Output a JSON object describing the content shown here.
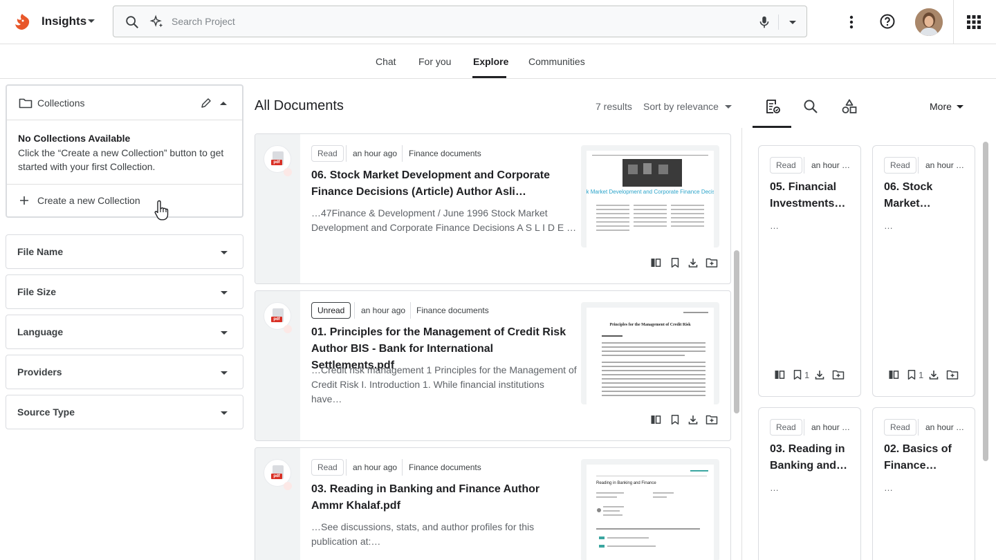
{
  "header": {
    "app_name": "Insights",
    "search_placeholder": "Search Project"
  },
  "tabs": [
    "Chat",
    "For you",
    "Explore",
    "Communities"
  ],
  "active_tab": "Explore",
  "collections": {
    "title": "Collections",
    "empty_title": "No Collections Available",
    "empty_desc": "Click the “Create a new Collection” button to get started with your first Collection.",
    "create_label": "Create a new Collection"
  },
  "filters": [
    "File Name",
    "File Size",
    "Language",
    "Providers",
    "Source Type"
  ],
  "main": {
    "title": "All Documents",
    "results": "7 results",
    "sort_label": "Sort by relevance"
  },
  "documents": [
    {
      "status": "Read",
      "time": "an hour ago",
      "source": "Finance documents",
      "title": "06. Stock Market Development and Corporate Finance Decisions (Article) Author Asli…",
      "snippet": "…47Finance & Development / June 1996 Stock Market Development and Corporate Finance Decisions A S L I D E …",
      "thumb_title": "Stock Market Development and Corporate Finance Decisions"
    },
    {
      "status": "Unread",
      "time": "an hour ago",
      "source": "Finance documents",
      "title": "01. Principles for the Management of Credit Risk Author BIS - Bank for International Settlements.pdf",
      "snippet": "…Credit risk management 1 Principles for the Management of Credit Risk I. Introduction 1. While financial institutions have…",
      "thumb_title": "Principles for the Management of Credit Risk"
    },
    {
      "status": "Read",
      "time": "an hour ago",
      "source": "Finance documents",
      "title": "03. Reading in Banking and Finance Author Ammr Khalaf.pdf",
      "snippet": "…See discussions, stats, and author profiles for this publication at:…",
      "thumb_title": "Reading in Banking and Finance"
    }
  ],
  "right_panel": {
    "more_label": "More",
    "cards": [
      {
        "status": "Read",
        "time": "an hour …",
        "title": "05. Financial Investments…",
        "snippet": "…",
        "count": "1"
      },
      {
        "status": "Read",
        "time": "an hour …",
        "title": "06. Stock Market…",
        "snippet": "…",
        "count": "1"
      },
      {
        "status": "Read",
        "time": "an hour …",
        "title": "03. Reading in Banking and…",
        "snippet": "…",
        "count": ""
      },
      {
        "status": "Read",
        "time": "an hour …",
        "title": "02. Basics of Finance…",
        "snippet": "…",
        "count": ""
      }
    ]
  },
  "colors": {
    "accent": "#202124",
    "pdf_red": "#d93025",
    "logo_orange": "#e8572a"
  }
}
